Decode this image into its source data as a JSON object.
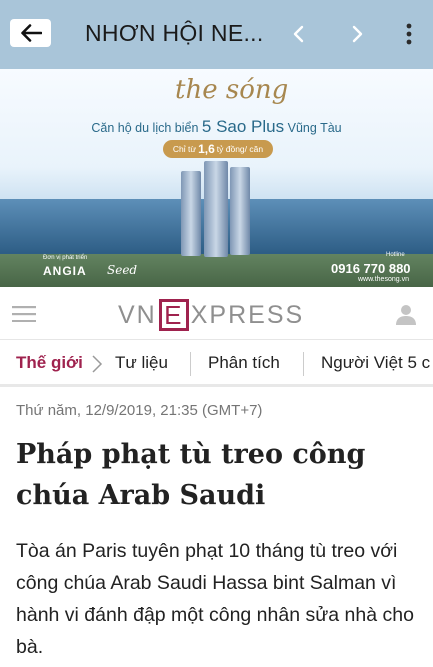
{
  "topbar": {
    "title": "NHƠN HỘI NE...",
    "back_icon": "arrow-left-icon",
    "prev_icon": "chevron-left-icon",
    "next_icon": "chevron-right-icon",
    "menu_icon": "more-vertical-icon"
  },
  "banner": {
    "brand": "the sóng",
    "tagline_prefix": "Căn hộ du lịch biển",
    "tagline_highlight": "5 Sao Plus",
    "tagline_suffix": "Vũng Tàu",
    "price_prefix": "Chỉ từ",
    "price_value": "1,6",
    "price_suffix": "tỷ đồng/ căn",
    "developer_label": "Đơn vị phát triển",
    "developer_1": "ANGIA",
    "developer_2": "Seed",
    "hotline_label": "Hotline",
    "hotline": "0916 770 880",
    "website": "www.thesong.vn"
  },
  "site": {
    "logo_left": "VN",
    "logo_box": "E",
    "logo_right": "XPRESS",
    "brand_color": "#9f224e"
  },
  "categories": {
    "active": "Thế giới",
    "items": [
      "Tư liệu",
      "Phân tích",
      "Người Việt 5 c"
    ]
  },
  "article": {
    "date": "Thứ năm, 12/9/2019, 21:35 (GMT+7)",
    "title": "Pháp phạt tù treo công chúa Arab Saudi",
    "lead": "Tòa án Paris tuyên phạt 10 tháng tù treo với công chúa Arab Saudi Hassa bint Salman vì hành vi đánh đập một công nhân sửa nhà cho bà."
  }
}
